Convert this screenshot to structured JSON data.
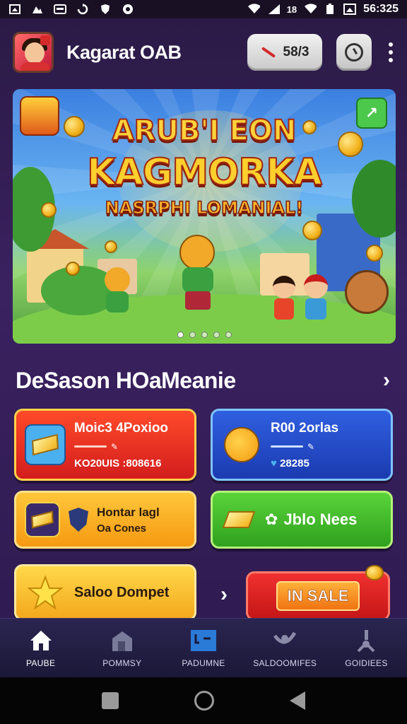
{
  "status_bar": {
    "time": "56:325",
    "signal_text": "18",
    "icons": [
      "screenshot-icon",
      "image-icon",
      "message-icon",
      "sync-icon",
      "shield-icon",
      "settings-icon",
      "wifi-icon",
      "cell-signal-icon",
      "battery-icon",
      "photo-icon"
    ]
  },
  "header": {
    "app_title": "Kagarat OAB",
    "coin_value": "58/3",
    "avatar_icon": "player-avatar",
    "timer_icon": "timer-icon",
    "menu_icon": "more-vert-icon"
  },
  "banner": {
    "line1": "ARUB'I EON",
    "line2": "KAGMORKA",
    "line3": "NASRPHI LOMANIAL!",
    "slide_count": 5,
    "active_slide": 0
  },
  "section": {
    "title": "DeSason HOaMeanie",
    "chevron": "›"
  },
  "cards": {
    "red": {
      "title": "Moic3 4Poxioo",
      "sub": "KO20UIS :808616",
      "accent": "#d31d1d"
    },
    "blue": {
      "title": "R00 2orlas",
      "sub": "28285",
      "accent": "#1b3bb0"
    },
    "orange": {
      "title": "Hontar lagl",
      "sub": "Oa Cones",
      "accent": "#f59a12"
    },
    "green": {
      "title": "Jblo Nees",
      "accent": "#2fa11e"
    },
    "yellow": {
      "title": "Saloo Dompet",
      "accent": "#f4a81c"
    },
    "sale": {
      "label": "IN SALE"
    }
  },
  "side_chevron": "›",
  "bottom_nav": {
    "items": [
      {
        "label": "PAUBE",
        "icon": "home-icon",
        "active": true
      },
      {
        "label": "POMMSY",
        "icon": "shop-icon",
        "active": false
      },
      {
        "label": "PADUMNE",
        "icon": "events-icon",
        "active": false
      },
      {
        "label": "SALDOOMIFES",
        "icon": "rewards-icon",
        "active": false
      },
      {
        "label": "GOIDIEES",
        "icon": "profile-icon",
        "active": false
      }
    ]
  },
  "colors": {
    "background": "#2a1a44",
    "headline": "#ffd23a",
    "nav_bg": "#1c1838"
  }
}
